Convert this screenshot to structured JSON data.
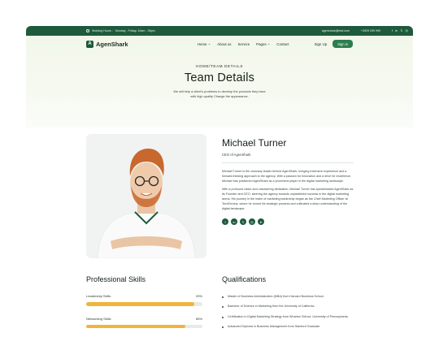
{
  "topbar": {
    "working_label": "Working Hours :",
    "working_hours": "Monday - Friday, 10am - 05pm",
    "email": "agenshark@test.com",
    "phone": "+3929 299 999",
    "social_icons": [
      "facebook-icon",
      "linkedin-icon",
      "x-icon",
      "instagram-icon"
    ],
    "social_glyphs": [
      "f",
      "in",
      "𝕏",
      "◎"
    ]
  },
  "nav": {
    "logo_mark": "A",
    "logo_text": "AgenShark",
    "items": [
      {
        "label": "Home",
        "dropdown": true
      },
      {
        "label": "About us",
        "dropdown": false
      },
      {
        "label": "Service",
        "dropdown": false
      },
      {
        "label": "Pages",
        "dropdown": true
      },
      {
        "label": "Contact",
        "dropdown": false
      }
    ],
    "signup": "Sign Up",
    "signin": "Sign in"
  },
  "hero": {
    "breadcrumb": "HOME/TEAM DETAILS",
    "title": "Team Details",
    "subtitle_line1": "We will help a client's problems to develop the products they have",
    "subtitle_line2": "with high quality Change the appearance."
  },
  "member": {
    "name": "Michael Turner",
    "role": "CEO of AgenShark",
    "bio_1": "Michael Turner is the visionary leader behind AgenShark, bringing extensive experience and a forward-thinking approach to the agency. With a passion for innovation and a drive for excellence, Michael has positioned AgenShark as a prominent player in the digital marketing landscape.",
    "bio_2": "With a profound vision and unwavering dedication, Michael Turner has spearheaded AgenShark as its Founder and CEO, steering the agency towards unparalleled success in the digital marketing arena. His journey in the realm of marketing leadership began as the Chief Marketing Officer at TechGenius, where he honed his strategic prowess and cultivated a deep understanding of the digital landscape.",
    "social_icons": [
      "facebook-icon",
      "linkedin-icon",
      "x-icon",
      "instagram-icon",
      "telegram-icon"
    ],
    "social_glyphs": [
      "f",
      "in",
      "𝕏",
      "◎",
      "➤"
    ]
  },
  "skills": {
    "heading": "Professional Skills",
    "items": [
      {
        "label": "Leadership Skills",
        "percent_text": "93%",
        "value": 93
      },
      {
        "label": "Networking Skills",
        "percent_text": "85%",
        "value": 85
      }
    ]
  },
  "qualifications": {
    "heading": "Qualifications",
    "items": [
      "Master of Business Administration (MBA) from Harvard Business School.",
      "Bachelor of Science in Marketing from the University of California",
      "Certification in Digital Marketing Strategy from Wharton School, University of Pennsylvania.",
      "Advanced Diploma in Business Management from Stanford Graduate"
    ]
  },
  "colors": {
    "brand": "#1e5a3c",
    "accent": "#f0b43c",
    "button": "#2e7d4f"
  }
}
